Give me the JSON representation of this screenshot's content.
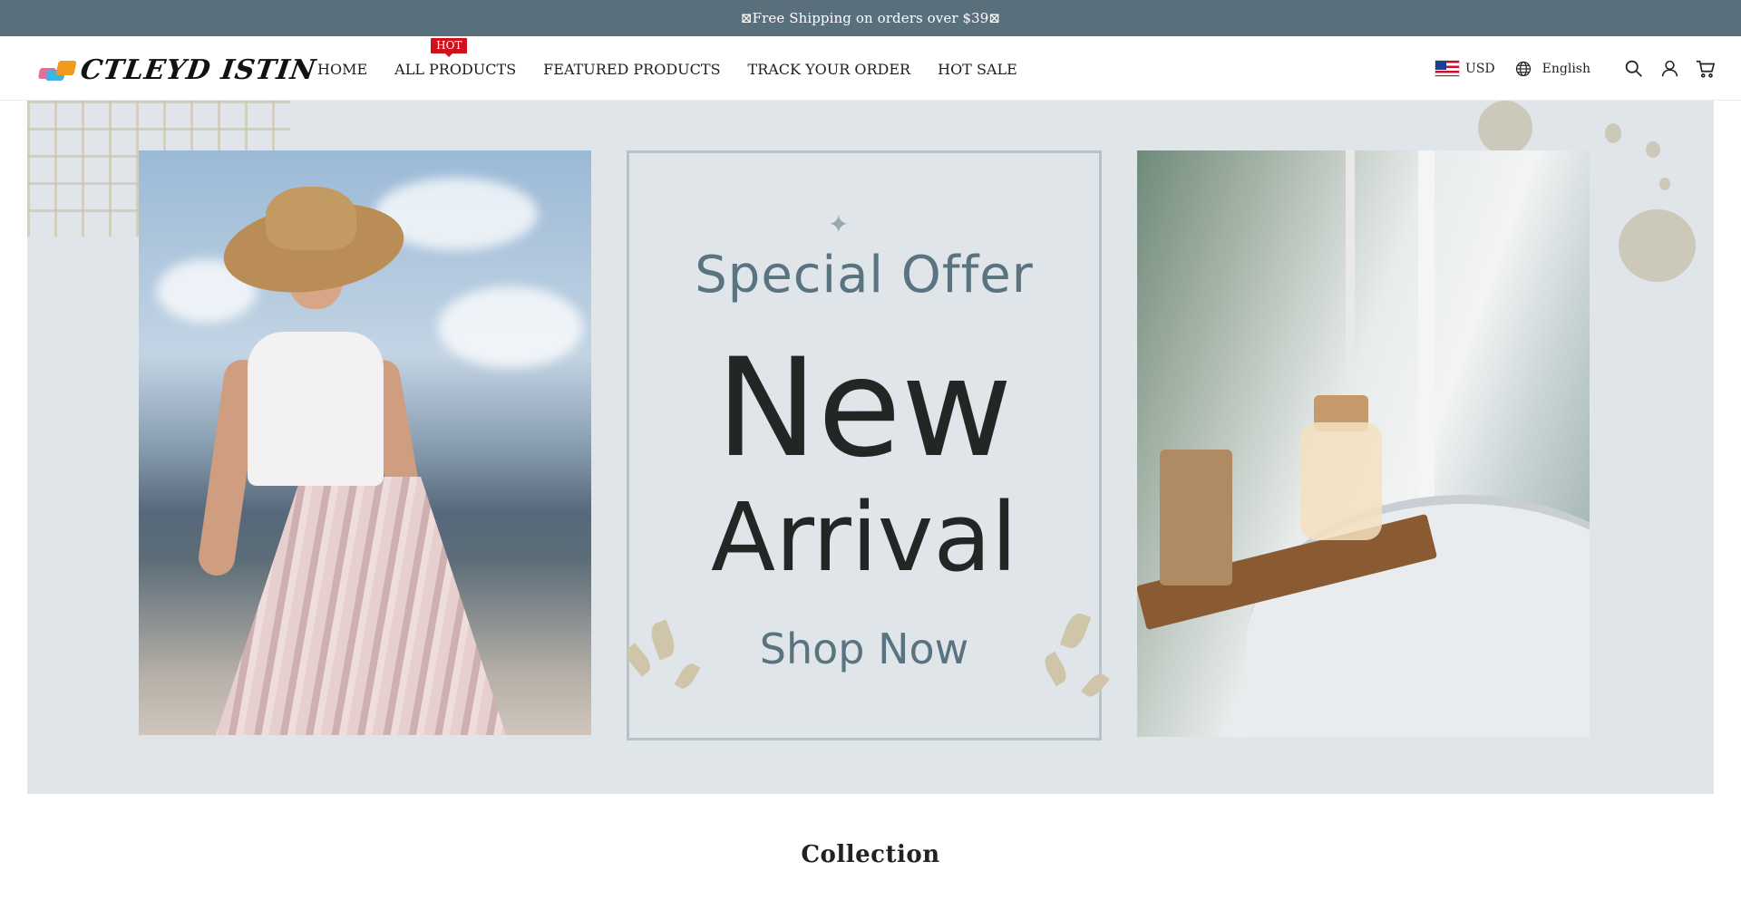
{
  "announcement": {
    "text": "⊠Free Shipping on orders over $39⊠"
  },
  "header": {
    "logo_text": "CTLEYD ISTIN",
    "nav": [
      {
        "label": "HOME"
      },
      {
        "label": "ALL PRODUCTS",
        "badge": "HOT"
      },
      {
        "label": "FEATURED PRODUCTS"
      },
      {
        "label": "TRACK YOUR ORDER"
      },
      {
        "label": "HOT SALE"
      }
    ],
    "currency": {
      "code": "USD",
      "flag_icon": "us-flag-icon"
    },
    "language": {
      "label": "English",
      "icon": "globe-icon"
    },
    "icons": [
      "search-icon",
      "account-icon",
      "cart-icon"
    ]
  },
  "hero": {
    "kicker": "Special Offer",
    "headline_line1": "New",
    "headline_line2": "Arrival",
    "cta": "Shop Now",
    "colors": {
      "background": "#dfe5e9",
      "accent": "#5a7380",
      "headline": "#222725"
    }
  },
  "sections": {
    "collection_title": "Collection"
  },
  "colors": {
    "announcement_bg": "#5a6f7c",
    "hot_badge": "#d0101c"
  }
}
